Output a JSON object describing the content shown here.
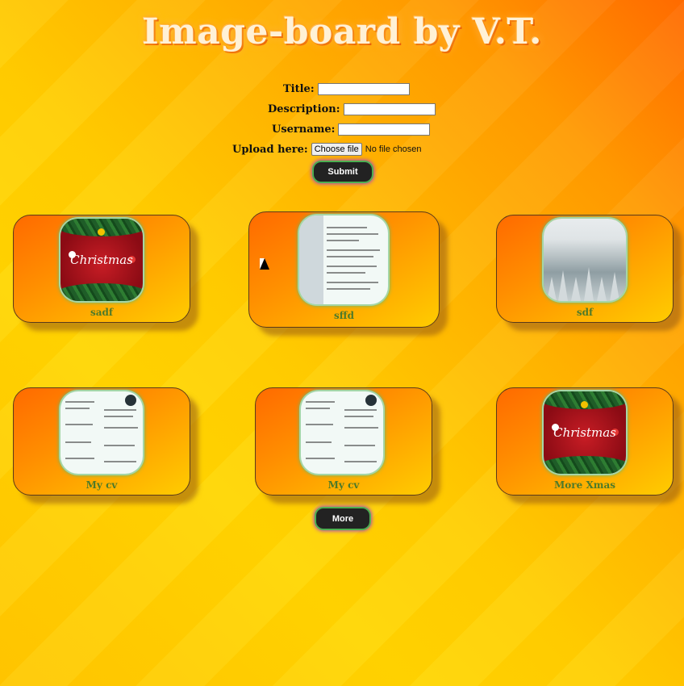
{
  "header": {
    "title": "Image-board by V.T."
  },
  "form": {
    "title_label": "Title:",
    "title_value": "",
    "description_label": "Description:",
    "description_value": "",
    "username_label": "Username:",
    "username_value": "",
    "upload_label": "Upload here:",
    "file_button": "Choose file",
    "file_status": "No file chosen",
    "submit_label": "Submit"
  },
  "cards": [
    {
      "caption": "sadf",
      "image": "christmas-card"
    },
    {
      "caption": "sffd",
      "image": "document-scan"
    },
    {
      "caption": "sdf",
      "image": "snowy-forest"
    },
    {
      "caption": "My cv",
      "image": "cv-document"
    },
    {
      "caption": "My cv",
      "image": "cv-document"
    },
    {
      "caption": "More Xmas",
      "image": "christmas-card"
    }
  ],
  "more_label": "More",
  "colors": {
    "caption": "#4d7a2a",
    "button": "#222222",
    "glow": "#4caf50"
  }
}
